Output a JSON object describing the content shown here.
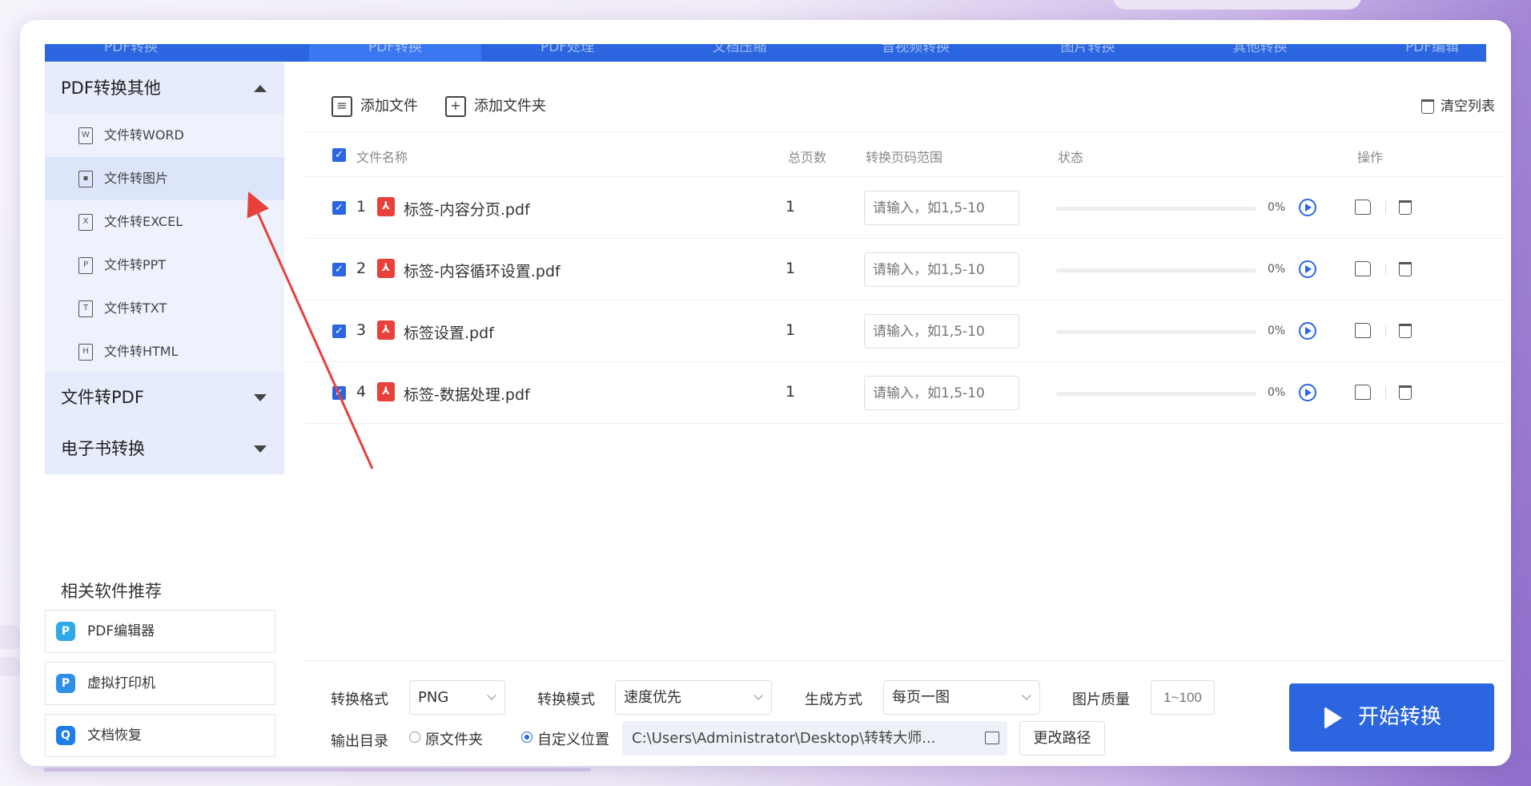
{
  "nav_tabs": [
    "PDF转换",
    "PDF处理",
    "文档压缩",
    "音视频转换",
    "图片转换",
    "其他转换",
    "PDF编辑"
  ],
  "sidebar": {
    "sections": [
      {
        "label": "PDF转换其他",
        "expanded": true
      },
      {
        "label": "文件转PDF",
        "expanded": false
      },
      {
        "label": "电子书转换",
        "expanded": false
      }
    ],
    "items": [
      {
        "label": "文件转WORD",
        "icon": "W"
      },
      {
        "label": "文件转图片",
        "icon": "img"
      },
      {
        "label": "文件转EXCEL",
        "icon": "X"
      },
      {
        "label": "文件转PPT",
        "icon": "P"
      },
      {
        "label": "文件转TXT",
        "icon": "T"
      },
      {
        "label": "文件转HTML",
        "icon": "H"
      }
    ],
    "active_item": "文件转图片",
    "related_title": "相关软件推荐",
    "related": [
      {
        "label": "PDF编辑器",
        "color": "#2fa8e8"
      },
      {
        "label": "虚拟打印机",
        "color": "#2f8fe8"
      },
      {
        "label": "文档恢复",
        "color": "#1f7ee6"
      }
    ]
  },
  "toolbar": {
    "add_file": "添加文件",
    "add_folder": "添加文件夹",
    "clear_list": "清空列表"
  },
  "table": {
    "headers": {
      "name": "文件名称",
      "pages": "总页数",
      "range": "转换页码范围",
      "status": "状态",
      "ops": "操作"
    },
    "rows": [
      {
        "index": "1",
        "name": "标签-内容分页.pdf",
        "pages": "1",
        "range_placeholder": "请输入，如1,5-10",
        "progress": 0,
        "percent": "0%"
      },
      {
        "index": "2",
        "name": "标签-内容循环设置.pdf",
        "pages": "1",
        "range_placeholder": "请输入，如1,5-10",
        "progress": 0,
        "percent": "0%"
      },
      {
        "index": "3",
        "name": "标签设置.pdf",
        "pages": "1",
        "range_placeholder": "请输入，如1,5-10",
        "progress": 0,
        "percent": "0%"
      },
      {
        "index": "4",
        "name": "标签-数据处理.pdf",
        "pages": "1",
        "range_placeholder": "请输入，如1,5-10",
        "progress": 0,
        "percent": "0%"
      }
    ]
  },
  "bottom": {
    "format_label": "转换格式",
    "format_value": "PNG",
    "mode_label": "转换模式",
    "mode_value": "速度优先",
    "gen_label": "生成方式",
    "gen_value": "每页一图",
    "quality_label": "图片质量",
    "quality_placeholder": "1~100",
    "output_label": "输出目录",
    "radio_original": "原文件夹",
    "radio_custom": "自定义位置",
    "output_path": "C:\\Users\\Administrator\\Desktop\\转转大师...",
    "change_path": "更改路径",
    "start": "开始转换"
  },
  "colors": {
    "accent": "#2b66e0",
    "annotation_arrow": "#e8403a"
  }
}
